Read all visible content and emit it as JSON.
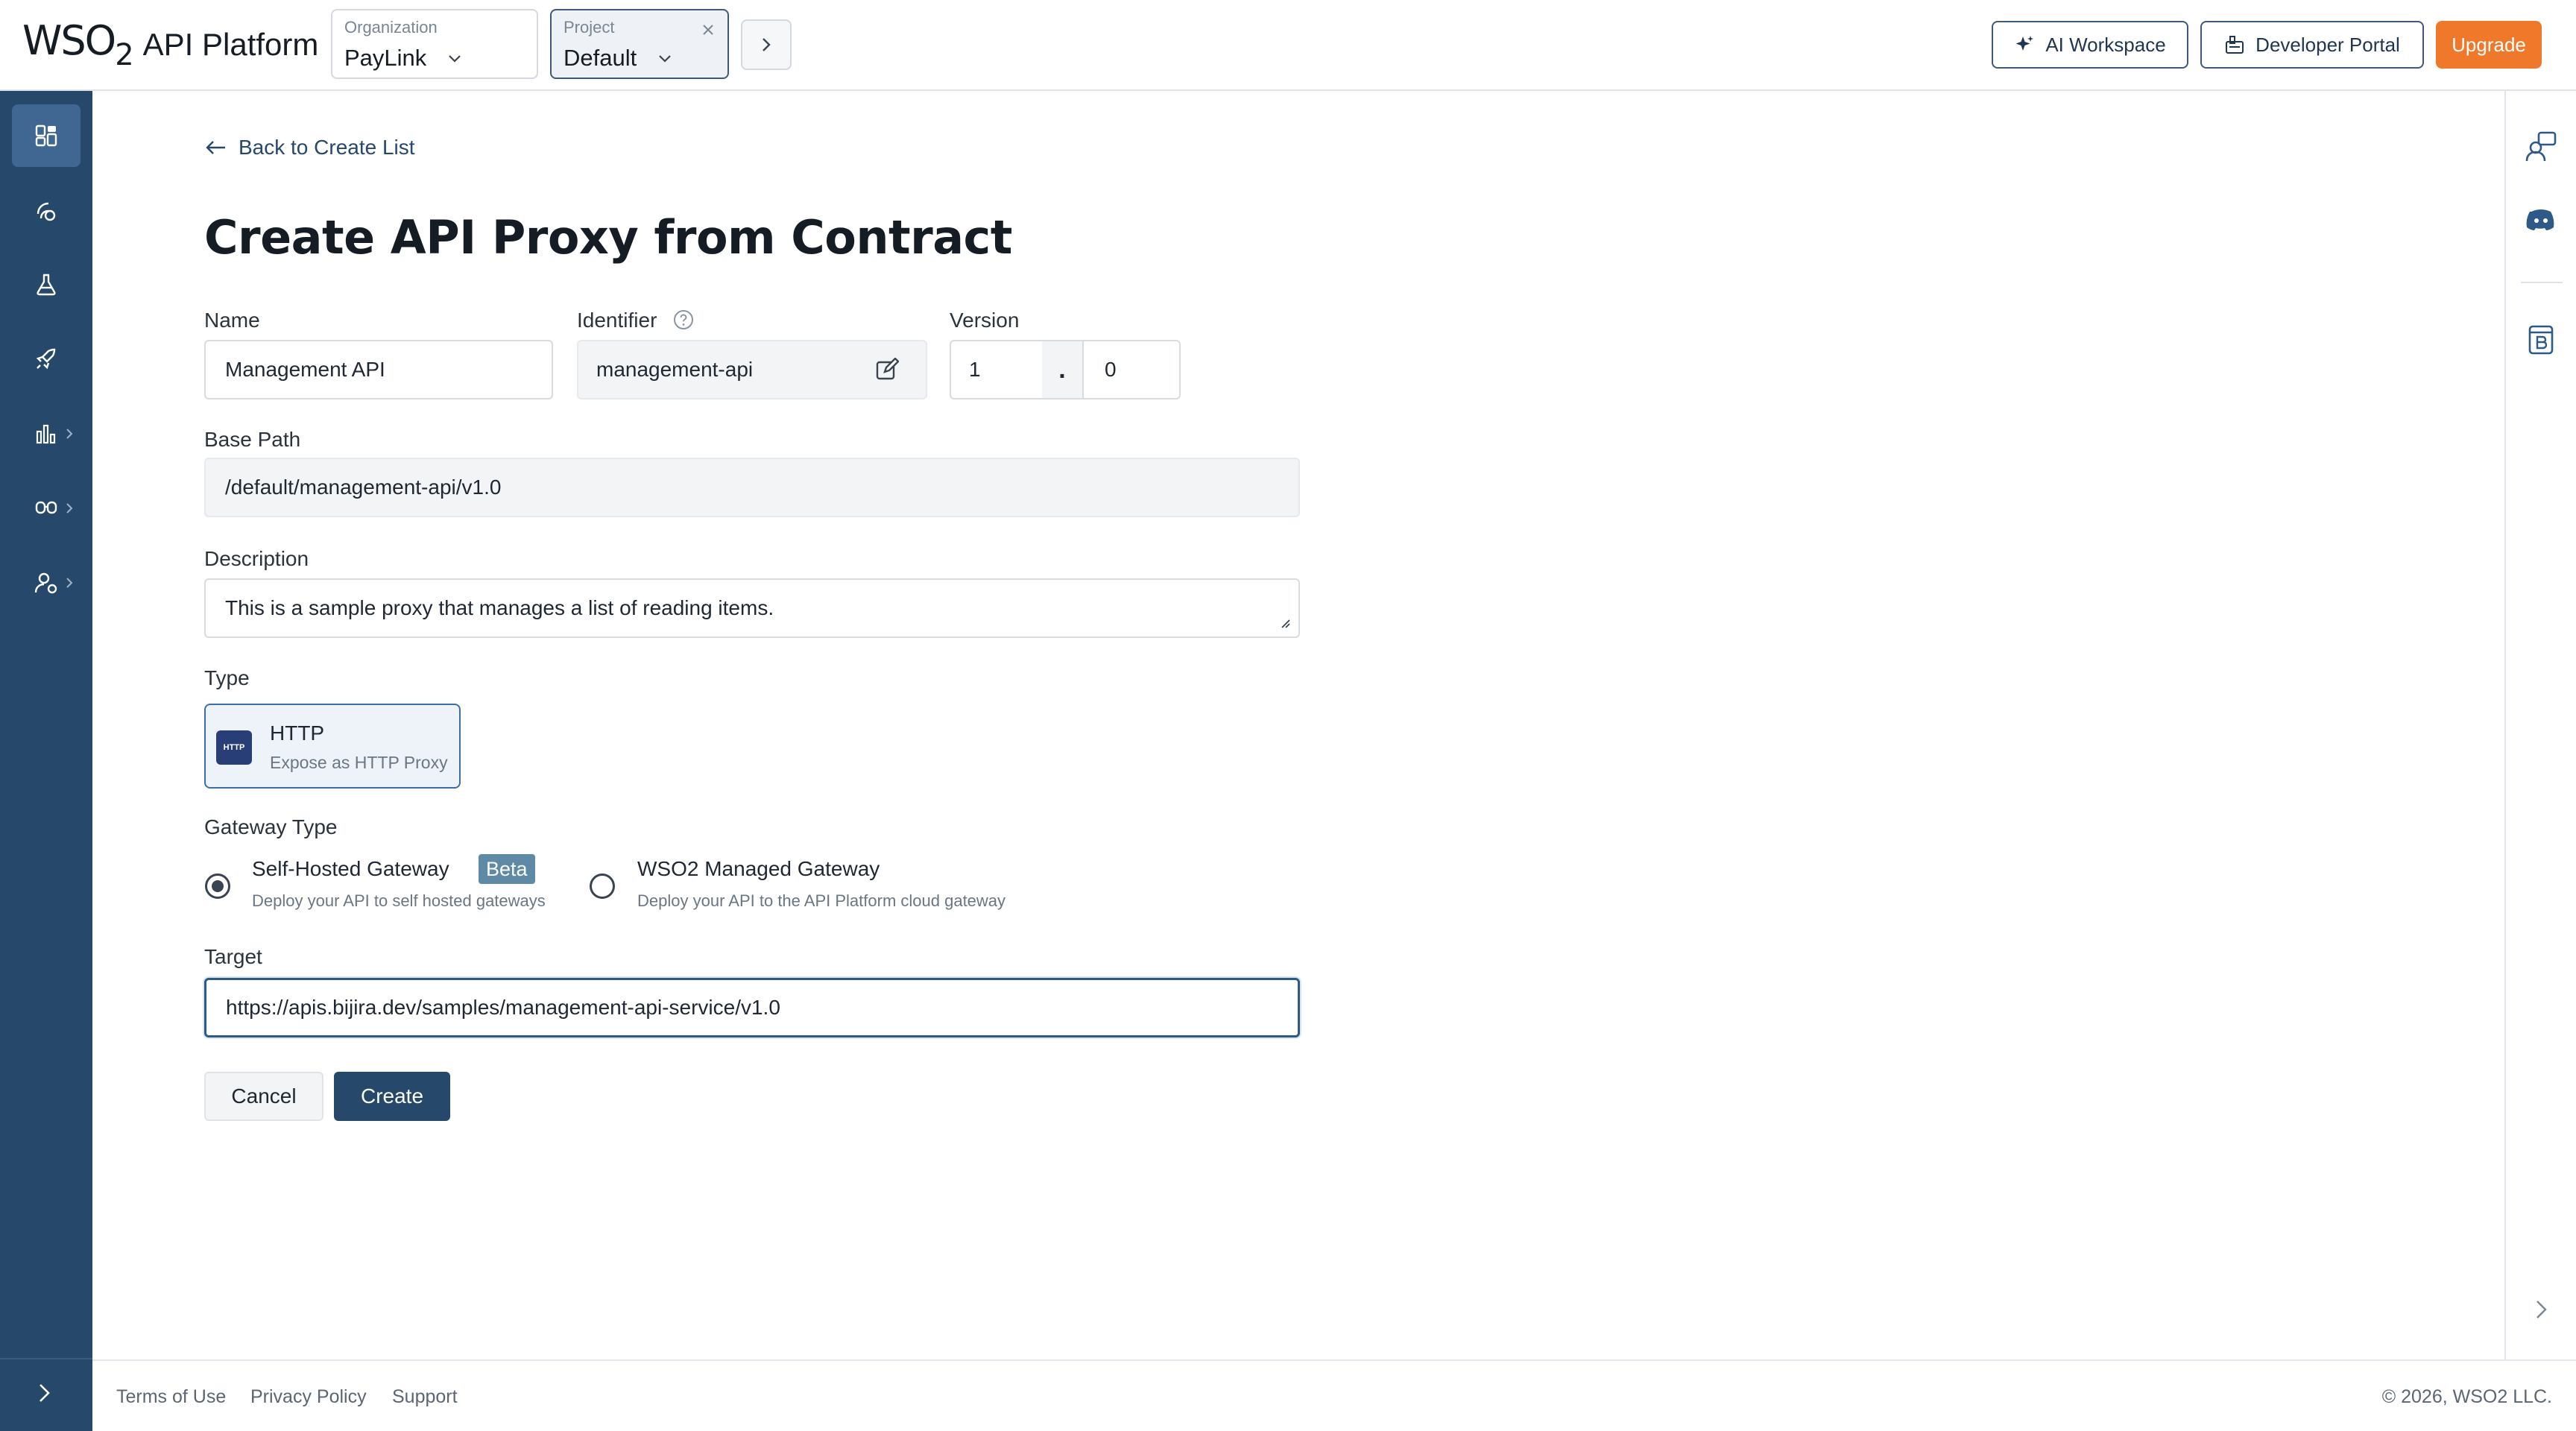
{
  "app": {
    "logo_brand": "WSO2",
    "logo_text": "API Platform"
  },
  "topbar": {
    "org_caption": "Organization",
    "org_value": "PayLink",
    "project_caption": "Project",
    "project_value": "Default",
    "ai_workspace_label": "AI Workspace",
    "developer_portal_label": "Developer Portal",
    "upgrade_label": "Upgrade"
  },
  "form": {
    "back_label": "Back to Create List",
    "title": "Create API Proxy from Contract",
    "name_label": "Name",
    "name_value": "Management API",
    "identifier_label": "Identifier",
    "identifier_value": "management-api",
    "version_label": "Version",
    "version_major": "1",
    "version_sep": ".",
    "version_minor": "0",
    "base_path_label": "Base Path",
    "base_path_value": "/default/management-api/v1.0",
    "description_label": "Description",
    "description_value": "This is a sample proxy that manages a list of reading items.",
    "type_label": "Type",
    "type_badge": "HTTP",
    "type_title": "HTTP",
    "type_desc": "Expose as HTTP Proxy",
    "gateway_label": "Gateway Type",
    "gateway_options": [
      {
        "title": "Self-Hosted Gateway",
        "desc": "Deploy your API to self hosted gateways",
        "badge": "Beta",
        "selected": true
      },
      {
        "title": "WSO2 Managed Gateway",
        "desc": "Deploy your API to the API Platform cloud gateway",
        "selected": false
      }
    ],
    "target_label": "Target",
    "target_value": "https://apis.bijira.dev/samples/management-api-service/v1.0",
    "cancel_label": "Cancel",
    "create_label": "Create"
  },
  "footer": {
    "links": [
      "Terms of Use",
      "Privacy Policy",
      "Support"
    ],
    "copyright": "© 2026, WSO2 LLC."
  },
  "colors": {
    "sidebar": "#26486a",
    "accent": "#26486a",
    "upgrade": "#f0782a",
    "beta_badge": "#5f8aa5"
  },
  "icons": {
    "sidebar": [
      "overview-icon",
      "design-icon",
      "test-icon",
      "deploy-icon",
      "analytics-icon",
      "governance-icon",
      "admin-icon"
    ],
    "rail": [
      "support-agent-icon",
      "discord-icon",
      "notes-icon"
    ]
  }
}
